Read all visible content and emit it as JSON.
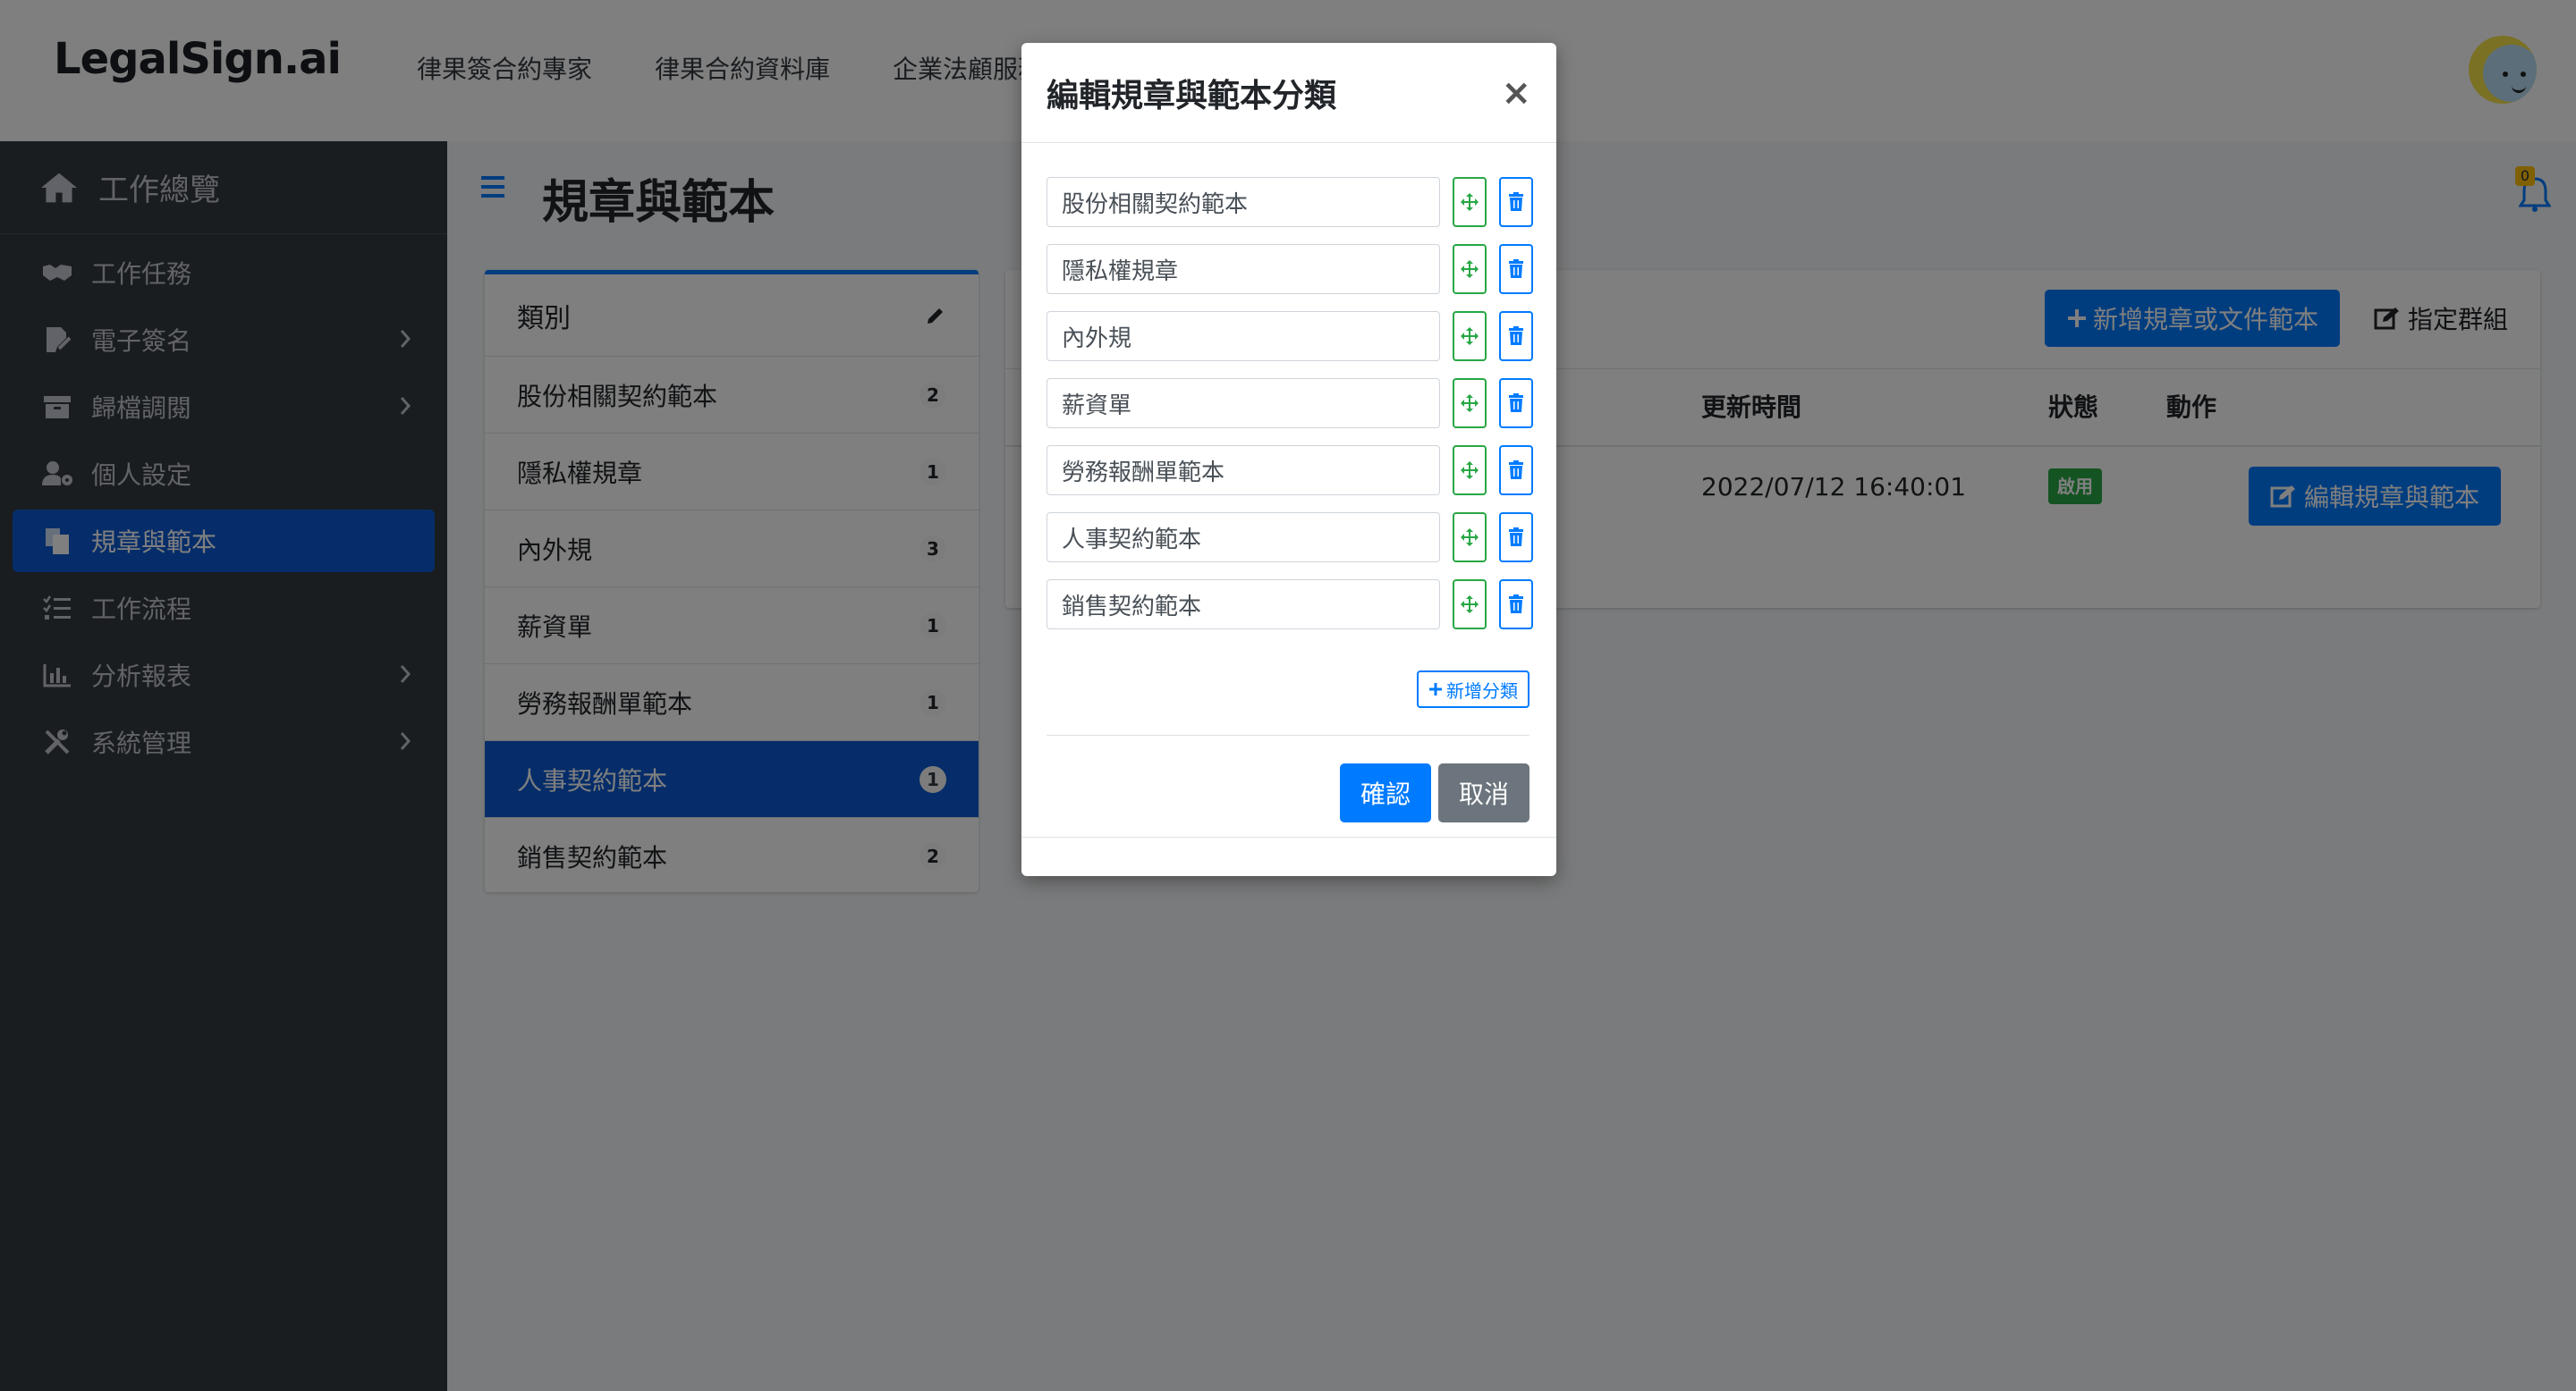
{
  "brand": {
    "logo": "LegalSign.ai"
  },
  "topnav": {
    "items": [
      "律果簽合約專家",
      "律果合約資料庫",
      "企業法顧服務"
    ]
  },
  "sidebar": {
    "header": "工作總覽",
    "items": [
      {
        "label": "工作任務",
        "icon": "handshake-icon",
        "has_submenu": false
      },
      {
        "label": "電子簽名",
        "icon": "signature-icon",
        "has_submenu": true
      },
      {
        "label": "歸檔調閱",
        "icon": "archive-icon",
        "has_submenu": true
      },
      {
        "label": "個人設定",
        "icon": "user-cog-icon",
        "has_submenu": false
      },
      {
        "label": "規章與範本",
        "icon": "copy-icon",
        "has_submenu": false,
        "active": true
      },
      {
        "label": "工作流程",
        "icon": "list-check-icon",
        "has_submenu": false
      },
      {
        "label": "分析報表",
        "icon": "chart-bar-icon",
        "has_submenu": true
      },
      {
        "label": "系統管理",
        "icon": "tools-icon",
        "has_submenu": true
      }
    ]
  },
  "page": {
    "title": "規章與範本",
    "notification_count": "0"
  },
  "categories": {
    "header": "類別",
    "items": [
      {
        "label": "股份相關契約範本",
        "count": "2"
      },
      {
        "label": "隱私權規章",
        "count": "1"
      },
      {
        "label": "內外規",
        "count": "3"
      },
      {
        "label": "薪資單",
        "count": "1"
      },
      {
        "label": "勞務報酬單範本",
        "count": "1"
      },
      {
        "label": "人事契約範本",
        "count": "1",
        "active": true
      },
      {
        "label": "銷售契約範本",
        "count": "2"
      }
    ]
  },
  "main": {
    "add_button": "新增規章或文件範本",
    "assign_button": "指定群組",
    "columns": {
      "updated": "更新時間",
      "status": "狀態",
      "action": "動作"
    },
    "row": {
      "updated": "2022/07/12 16:40:01",
      "status": "啟用",
      "edit_button": "編輯規章與範本"
    }
  },
  "modal": {
    "title": "編輯規章與範本分類",
    "close": "×",
    "categories": [
      "股份相關契約範本",
      "隱私權規章",
      "內外規",
      "薪資單",
      "勞務報酬單範本",
      "人事契約範本",
      "銷售契約範本"
    ],
    "add_category": "新增分類",
    "confirm": "確認",
    "cancel": "取消"
  },
  "colors": {
    "primary": "#007bff",
    "sidebar_bg": "#343a40",
    "active_nav": "#0d5bd2",
    "success": "#28a745",
    "secondary": "#6c757d"
  }
}
